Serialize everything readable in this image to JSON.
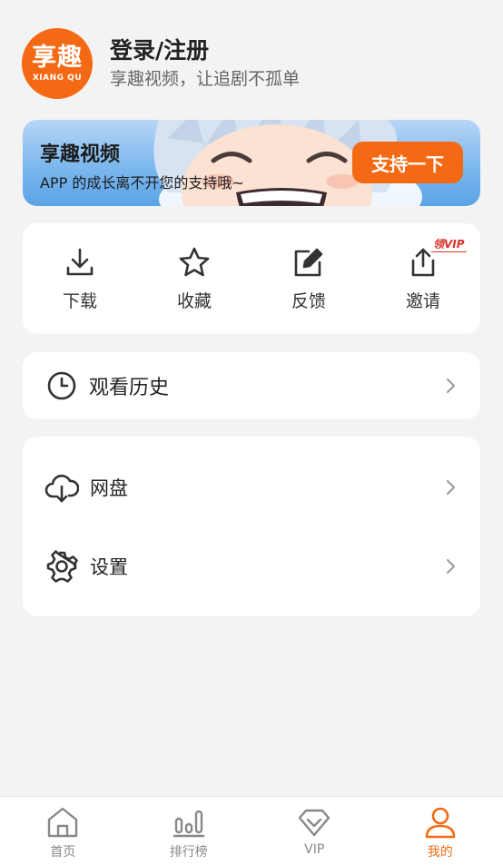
{
  "profile": {
    "avatar_logo_cn": "享趣",
    "avatar_logo_en": "XIANG QU",
    "login_label": "登录/注册",
    "subtitle": "享趣视频，让追剧不孤单"
  },
  "banner": {
    "title": "享趣视频",
    "subtitle": "APP 的成长离不开您的支持哦~",
    "button_label": "支持一下"
  },
  "quick_actions": [
    {
      "label": "下载",
      "icon": "download-icon"
    },
    {
      "label": "收藏",
      "icon": "star-icon"
    },
    {
      "label": "反馈",
      "icon": "edit-icon"
    },
    {
      "label": "邀请",
      "icon": "share-icon",
      "badge": "领VIP"
    }
  ],
  "history": {
    "label": "观看历史",
    "icon": "clock-icon"
  },
  "menu": [
    {
      "label": "网盘",
      "icon": "cloud-download-icon"
    },
    {
      "label": "设置",
      "icon": "gear-icon"
    }
  ],
  "tabbar": {
    "items": [
      {
        "label": "首页",
        "icon": "home-icon"
      },
      {
        "label": "排行榜",
        "icon": "ranking-icon"
      },
      {
        "label": "VIP",
        "icon": "diamond-icon"
      },
      {
        "label": "我的",
        "icon": "user-icon"
      }
    ],
    "active_index": 3
  },
  "colors": {
    "accent": "#f46a14",
    "background": "#f3f3f4",
    "badge_red": "#d9342b"
  }
}
